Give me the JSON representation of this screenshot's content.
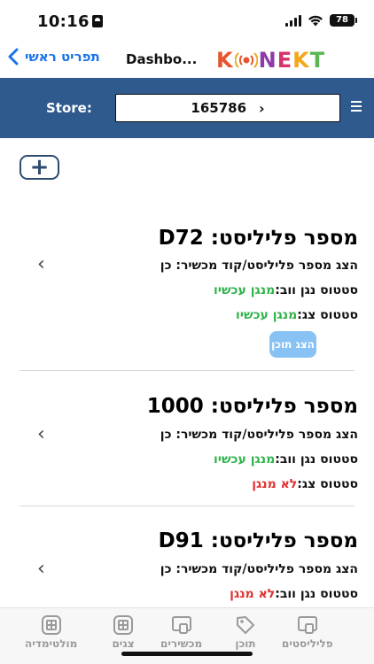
{
  "status_bar": {
    "time": "10:16",
    "battery": "78"
  },
  "nav": {
    "back_label": "תפריט ראשי",
    "title": "Dashbo...",
    "logo": {
      "k": "K",
      "n": "N",
      "e": "E",
      "k2": "K",
      "t": "T"
    }
  },
  "store": {
    "label": "Store:",
    "value": "165786",
    "chevron": "›"
  },
  "add_button": {
    "symbol": "+"
  },
  "playlists": [
    {
      "title": "מספר פליליסט: D72",
      "code_line": "הצג מספר פליליסט/קוד מכשיר: כן",
      "web_player_label": "סטטוס נגן ווב:",
      "web_player_status": "מנגן עכשיו",
      "screen_label": "סטטוס צג:",
      "screen_status": "מנגן עכשיו",
      "button_label": "הצג תוכן"
    },
    {
      "title": "מספר פליליסט: 1000",
      "code_line": "הצג מספר פליליסט/קוד מכשיר: כן",
      "web_player_label": "סטטוס נגן ווב:",
      "web_player_status": "מנגן עכשיו",
      "screen_label": "סטטוס צג:",
      "screen_status": "לא מנגן"
    },
    {
      "title": "מספר פליליסט: D91",
      "code_line": "הצג מספר פליליסט/קוד מכשיר: כן",
      "web_player_label": "סטטוס נגן ווב:",
      "web_player_status": "לא מנגן"
    }
  ],
  "tabs": [
    {
      "label": "פליליסטים",
      "icon": "playlist-icon"
    },
    {
      "label": "תוכן",
      "icon": "content-tag-icon"
    },
    {
      "label": "מכשירים",
      "icon": "devices-icon"
    },
    {
      "label": "צגים",
      "icon": "screens-icon"
    },
    {
      "label": "מולטימדיה",
      "icon": "multimedia-icon"
    }
  ],
  "colors": {
    "header_bg": "#2e5a8e",
    "accent": "#1a73e8",
    "playing": "#2fb34a",
    "not_playing": "#e03131",
    "button": "#88c1f3"
  }
}
